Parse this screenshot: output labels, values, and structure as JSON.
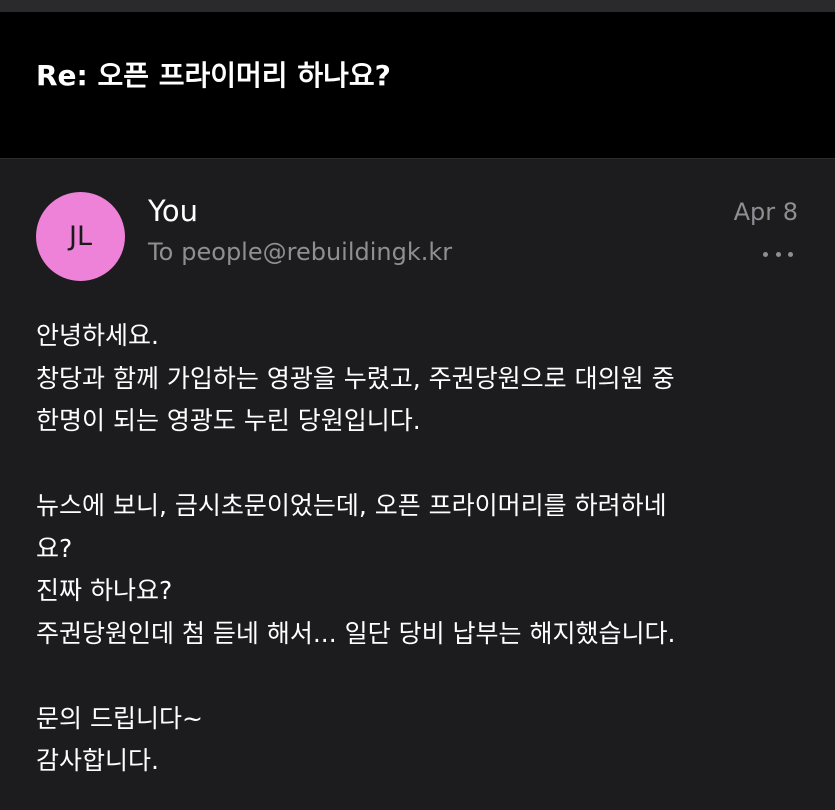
{
  "header": {
    "subject": "Re: 오픈 프라이머리 하나요?"
  },
  "message": {
    "avatar_initials": "JL",
    "avatar_color": "#ee82d8",
    "sender": "You",
    "recipient_prefix": "To",
    "recipient": "people@rebuildingk.kr",
    "date": "Apr 8",
    "more_icon": "ellipsis-icon",
    "body_lines": [
      "안녕하세요.",
      "창당과 함께 가입하는 영광을 누렸고, 주권당원으로 대의원 중",
      "한명이 되는 영광도 누린 당원입니다.",
      "",
      "뉴스에 보니, 금시초문이었는데, 오픈 프라이머리를 하려하네",
      "요?",
      "진짜 하나요?",
      "주권당원인데 첨 듣네 해서... 일단 당비 납부는 해지했습니다.",
      "",
      "문의 드립니다~",
      "감사합니다."
    ]
  }
}
